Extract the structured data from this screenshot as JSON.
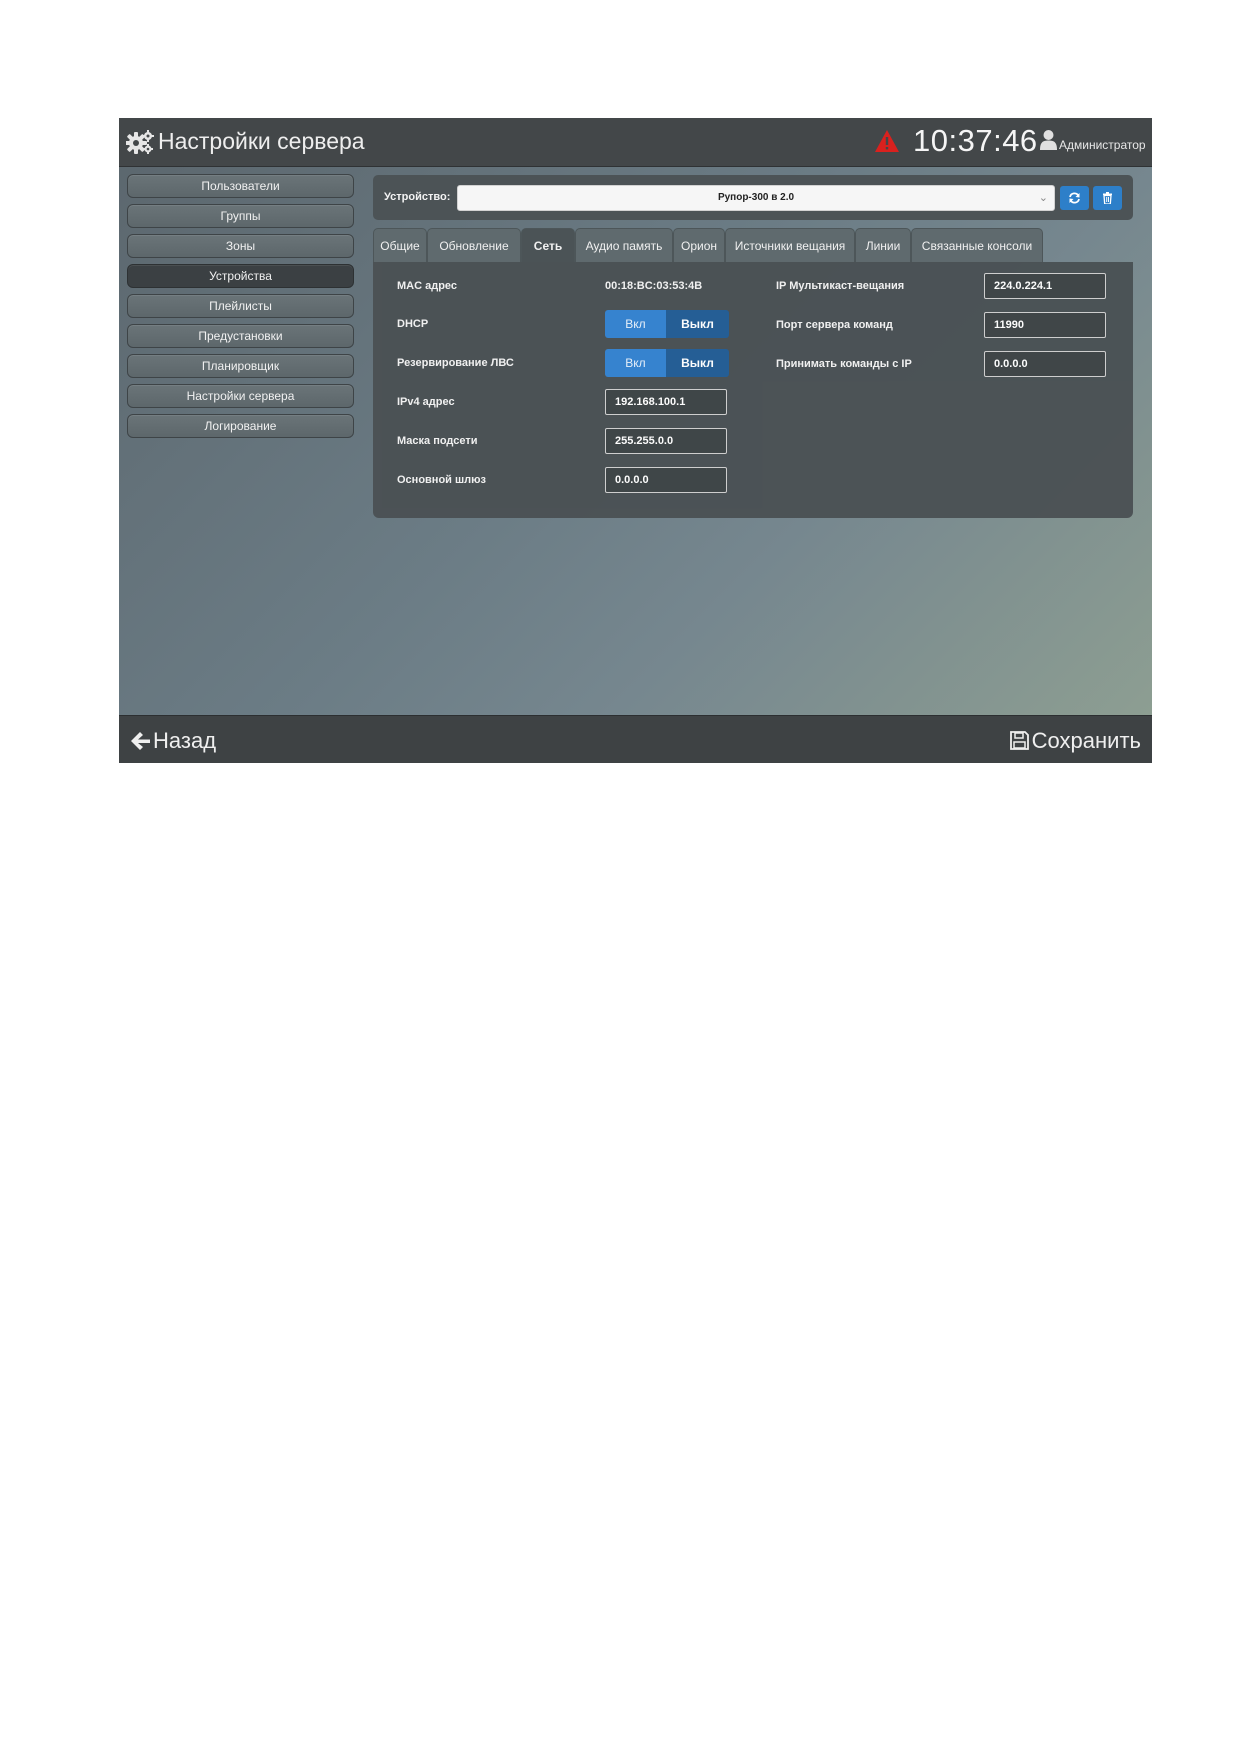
{
  "header": {
    "title": "Настройки сервера",
    "clock": "10:37:46",
    "user": "Администратор",
    "icons": {
      "settings": "gears-icon",
      "alert": "warning-triangle-icon",
      "user": "user-icon"
    },
    "alert_color": "#d9211e"
  },
  "sidebar": {
    "items": [
      {
        "label": "Пользователи"
      },
      {
        "label": "Группы"
      },
      {
        "label": "Зоны"
      },
      {
        "label": "Устройства",
        "active": true
      },
      {
        "label": "Плейлисты"
      },
      {
        "label": "Предустановки"
      },
      {
        "label": "Планировщик"
      },
      {
        "label": "Настройки сервера"
      },
      {
        "label": "Логирование"
      }
    ]
  },
  "device": {
    "label": "Устройство:",
    "selected": "Рупор-300 в 2.0",
    "buttons": [
      "refresh-icon",
      "trash-icon"
    ],
    "accent": "#2d7fc9"
  },
  "tabs": [
    {
      "label": "Общие"
    },
    {
      "label": "Обновление"
    },
    {
      "label": "Сеть",
      "active": true
    },
    {
      "label": "Аудио память"
    },
    {
      "label": "Орион"
    },
    {
      "label": "Источники вещания"
    },
    {
      "label": "Линии"
    },
    {
      "label": "Связанные консоли"
    }
  ],
  "network": {
    "mac_label": "MAC адрес",
    "mac_value": "00:18:BC:03:53:4B",
    "dhcp_label": "DHCP",
    "dhcp_on": "Вкл",
    "dhcp_off": "Выкл",
    "dhcp_state": "Выкл",
    "lan_label": "Резервирование ЛВС",
    "lan_on": "Вкл",
    "lan_off": "Выкл",
    "lan_state": "Выкл",
    "ipv4_label": "IPv4 адрес",
    "ipv4_value": "192.168.100.1",
    "mask_label": "Маска подсети",
    "mask_value": "255.255.0.0",
    "gateway_label": "Основной шлюз",
    "gateway_value": "0.0.0.0",
    "multicast_label": "IP Мультикаст-вещания",
    "multicast_value": "224.0.224.1",
    "port_label": "Порт сервера команд",
    "port_value": "11990",
    "accept_label": "Принимать команды с IP",
    "accept_value": "0.0.0.0"
  },
  "footer": {
    "back_label": "Назад",
    "save_label": "Сохранить"
  }
}
